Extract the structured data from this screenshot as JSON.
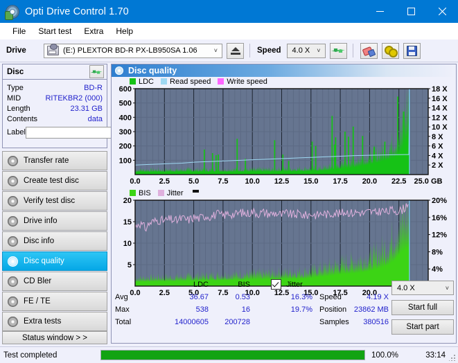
{
  "window": {
    "title": "Opti Drive Control 1.70",
    "icon": "disc-drive-icon",
    "minimize": "minimize-icon",
    "maximize": "maximize-icon",
    "close": "close-icon"
  },
  "menu": [
    "File",
    "Start test",
    "Extra",
    "Help"
  ],
  "toolbar": {
    "drive_label": "Drive",
    "drive_value": "(E:)  PLEXTOR BD-R  PX-LB950SA 1.06",
    "eject_icon": "eject-icon",
    "speed_label": "Speed",
    "speed_value": "4.0 X",
    "refresh_icon": "refresh-icon",
    "erase_icon": "eraser-icon",
    "settings_icon": "gears-icon",
    "save_icon": "floppy-save-icon"
  },
  "disc": {
    "title": "Disc",
    "refresh_icon": "refresh-icon",
    "rows": [
      {
        "key": "Type",
        "value": "BD-R"
      },
      {
        "key": "MID",
        "value": "RITEKBR2 (000)"
      },
      {
        "key": "Length",
        "value": "23.31 GB"
      },
      {
        "key": "Contents",
        "value": "data"
      }
    ],
    "label_key": "Label",
    "label_value": "",
    "label_placeholder": "",
    "label_button_icon": "cd-disc-icon"
  },
  "nav": {
    "items": [
      {
        "label": "Transfer rate",
        "active": false
      },
      {
        "label": "Create test disc",
        "active": false
      },
      {
        "label": "Verify test disc",
        "active": false
      },
      {
        "label": "Drive info",
        "active": false
      },
      {
        "label": "Disc info",
        "active": false
      },
      {
        "label": "Disc quality",
        "active": true
      },
      {
        "label": "CD Bler",
        "active": false
      },
      {
        "label": "FE / TE",
        "active": false
      },
      {
        "label": "Extra tests",
        "active": false
      }
    ],
    "status_window": "Status window > >"
  },
  "panel": {
    "title": "Disc quality",
    "icon": "disc-quality-icon"
  },
  "stats": {
    "col_ldc": "LDC",
    "col_bis": "BIS",
    "row_avg": "Avg",
    "row_max": "Max",
    "row_total": "Total",
    "ldc_avg": "36.67",
    "ldc_max": "538",
    "ldc_total": "14000605",
    "bis_avg": "0.53",
    "bis_max": "16",
    "bis_total": "200728",
    "jitter_label": "Jitter",
    "jitter_checked": true,
    "jitter_avg": "16.3%",
    "jitter_max": "19.7%",
    "speed_label": "Speed",
    "speed_value": "4.19 X",
    "position_label": "Position",
    "position_value": "23862 MB",
    "samples_label": "Samples",
    "samples_value": "380516",
    "speed_select": "4.0 X",
    "start_full": "Start full",
    "start_part": "Start part"
  },
  "status": {
    "text": "Test completed",
    "percent": "100.0%",
    "progress": 100,
    "time": "33:14"
  },
  "colors": {
    "accent": "#0078d4",
    "plot_bg": "#667590",
    "ldc_green": "#16c216",
    "bis_green": "#3cd415",
    "read_speed": "#9fd8f2",
    "write_speed": "#ff66ff",
    "jitter": "#dfb0dd",
    "value_blue": "#2222cc",
    "progress_green": "#12a312"
  },
  "chart_data": [
    {
      "type": "area",
      "title": "LDC / Read speed",
      "xlabel": "GB",
      "ylabel": "LDC",
      "xlim": [
        0,
        25
      ],
      "ylim": [
        0,
        600
      ],
      "y2lim": [
        0,
        18
      ],
      "y2label": "X",
      "grid": true,
      "legend": [
        "LDC",
        "Read speed",
        "Write speed"
      ],
      "legend_position": "top-left",
      "xticks": [
        "0.0",
        "2.5",
        "5.0",
        "7.5",
        "10.0",
        "12.5",
        "15.0",
        "17.5",
        "20.0",
        "22.5",
        "25.0 GB"
      ],
      "yticks": [
        100,
        200,
        300,
        400,
        500,
        600
      ],
      "y2ticks": [
        "2 X",
        "4 X",
        "6 X",
        "8 X",
        "10 X",
        "12 X",
        "14 X",
        "16 X",
        "18 X"
      ],
      "data_end_gb": 23.4,
      "series": [
        {
          "name": "LDC",
          "color": "#16c216",
          "x": [
            0.0,
            0.4,
            0.8,
            1.2,
            1.6,
            2.0,
            2.4,
            2.8,
            3.2,
            3.6,
            4.0,
            4.4,
            4.8,
            5.2,
            5.6,
            6.0,
            6.4,
            6.8,
            7.2,
            7.6,
            8.0,
            8.4,
            8.8,
            9.2,
            9.6,
            10.0,
            10.4,
            10.8,
            11.2,
            11.6,
            12.0,
            12.4,
            12.8,
            13.2,
            13.6,
            14.0,
            14.4,
            14.8,
            15.2,
            15.6,
            16.0,
            16.4,
            16.8,
            17.2,
            17.6,
            18.0,
            18.4,
            18.8,
            19.2,
            19.6,
            20.0,
            20.4,
            20.8,
            21.2,
            21.6,
            22.0,
            22.4,
            22.8,
            23.2,
            23.4
          ],
          "y": [
            30,
            34,
            33,
            32,
            34,
            33,
            32,
            34,
            35,
            33,
            34,
            36,
            35,
            34,
            36,
            35,
            34,
            36,
            35,
            34,
            36,
            35,
            37,
            36,
            35,
            37,
            36,
            38,
            37,
            36,
            38,
            40,
            39,
            38,
            40,
            42,
            41,
            43,
            45,
            44,
            48,
            52,
            58,
            66,
            72,
            80,
            86,
            95,
            105,
            118,
            130,
            142,
            155,
            172,
            190,
            215,
            255,
            330,
            470,
            600
          ]
        },
        {
          "name": "LDC spikes",
          "color": "#16c216",
          "x": [
            5.9,
            6.6,
            6.9,
            7.1,
            8.7,
            9.4,
            11.9,
            12.6,
            13.1,
            15.1,
            15.4,
            16.8,
            17.0,
            17.1,
            17.9,
            18.2,
            18.6,
            19.4,
            20.4,
            21.3,
            22.4,
            22.9
          ],
          "y": [
            175,
            150,
            135,
            140,
            250,
            110,
            240,
            140,
            95,
            230,
            200,
            410,
            210,
            260,
            300,
            265,
            335,
            270,
            195,
            230,
            545,
            440
          ]
        },
        {
          "name": "Read speed",
          "color": "#9fd8f2",
          "unit": "X",
          "x": [
            0.0,
            1.0,
            2.0,
            3.0,
            4.0,
            5.0,
            6.0,
            7.0,
            8.0,
            9.0,
            10.0,
            11.0,
            12.0,
            13.0,
            14.0,
            15.0,
            16.0,
            17.0,
            18.0,
            19.0,
            20.0,
            21.0,
            22.0,
            23.0,
            23.35,
            23.4
          ],
          "y": [
            2.0,
            2.1,
            2.2,
            2.3,
            2.4,
            2.6,
            2.7,
            2.8,
            2.9,
            3.0,
            3.1,
            3.2,
            3.3,
            3.4,
            3.5,
            3.6,
            3.7,
            3.8,
            3.9,
            4.0,
            4.05,
            4.1,
            4.15,
            4.2,
            4.2,
            18.0
          ]
        },
        {
          "name": "Write speed",
          "color": "#ff66ff",
          "x": [],
          "y": []
        }
      ]
    },
    {
      "type": "area",
      "title": "BIS / Jitter",
      "xlabel": "GB",
      "ylabel": "BIS",
      "xlim": [
        0,
        25
      ],
      "ylim": [
        0,
        20
      ],
      "y2lim": [
        0,
        20
      ],
      "y2label": "%",
      "grid": true,
      "legend": [
        "BIS",
        "Jitter"
      ],
      "legend_position": "top-left",
      "xticks": [
        "0.0",
        "2.5",
        "5.0",
        "7.5",
        "10.0",
        "12.5",
        "15.0",
        "17.5",
        "20.0",
        "22.5",
        "25.0 GB"
      ],
      "yticks": [
        5,
        10,
        15,
        20
      ],
      "y2ticks": [
        "4%",
        "8%",
        "12%",
        "16%",
        "20%"
      ],
      "data_end_gb": 23.4,
      "series": [
        {
          "name": "BIS",
          "color": "#3cd415",
          "x": [
            0.0,
            0.5,
            1.0,
            1.5,
            2.0,
            2.5,
            3.0,
            3.5,
            4.0,
            4.5,
            5.0,
            5.5,
            6.0,
            6.5,
            7.0,
            7.5,
            8.0,
            8.5,
            9.0,
            9.5,
            10.0,
            10.5,
            11.0,
            11.5,
            12.0,
            12.5,
            13.0,
            13.5,
            14.0,
            14.5,
            15.0,
            15.5,
            16.0,
            16.5,
            17.0,
            17.5,
            18.0,
            18.5,
            19.0,
            19.5,
            20.0,
            20.5,
            21.0,
            21.5,
            22.0,
            22.5,
            23.0,
            23.4
          ],
          "y": [
            1.8,
            1.8,
            1.9,
            1.9,
            2.0,
            2.0,
            2.0,
            2.1,
            2.1,
            2.2,
            2.2,
            2.3,
            2.3,
            2.4,
            2.4,
            2.5,
            2.5,
            2.6,
            2.6,
            2.7,
            2.7,
            2.8,
            2.8,
            2.9,
            2.9,
            3.0,
            3.0,
            3.1,
            3.1,
            3.2,
            3.4,
            3.8,
            4.0,
            4.3,
            4.6,
            5.0,
            5.2,
            5.4,
            5.6,
            6.0,
            6.4,
            7.0,
            7.8,
            8.8,
            10.5,
            13.5,
            15.5,
            16.2
          ]
        },
        {
          "name": "Jitter",
          "color": "#dfb0dd",
          "unit": "%",
          "x": [
            0.0,
            0.3,
            0.6,
            0.9,
            1.2,
            1.5,
            2.0,
            2.5,
            3.0,
            3.5,
            4.0,
            4.5,
            5.0,
            5.5,
            6.0,
            6.5,
            7.0,
            7.5,
            8.0,
            8.5,
            9.0,
            9.5,
            10.0,
            10.5,
            11.0,
            11.5,
            12.0,
            12.5,
            13.0,
            13.5,
            14.0,
            14.5,
            15.0,
            15.5,
            16.0,
            16.5,
            17.0,
            17.5,
            18.0,
            18.5,
            19.0,
            19.5,
            20.0,
            20.5,
            21.0,
            21.5,
            22.0,
            22.5,
            23.0,
            23.3
          ],
          "y": [
            13.6,
            14.8,
            14.2,
            13.4,
            14.6,
            15.0,
            15.4,
            15.2,
            15.6,
            15.2,
            15.8,
            15.4,
            16.0,
            15.8,
            16.4,
            16.2,
            16.8,
            16.4,
            17.0,
            16.6,
            17.2,
            16.8,
            17.4,
            16.9,
            17.2,
            16.8,
            17.0,
            16.6,
            17.0,
            16.5,
            16.9,
            16.4,
            16.8,
            16.5,
            17.0,
            16.6,
            17.2,
            16.8,
            17.4,
            17.0,
            17.3,
            16.9,
            17.4,
            17.0,
            17.6,
            17.2,
            17.8,
            17.4,
            18.2,
            19.8
          ]
        }
      ]
    }
  ]
}
